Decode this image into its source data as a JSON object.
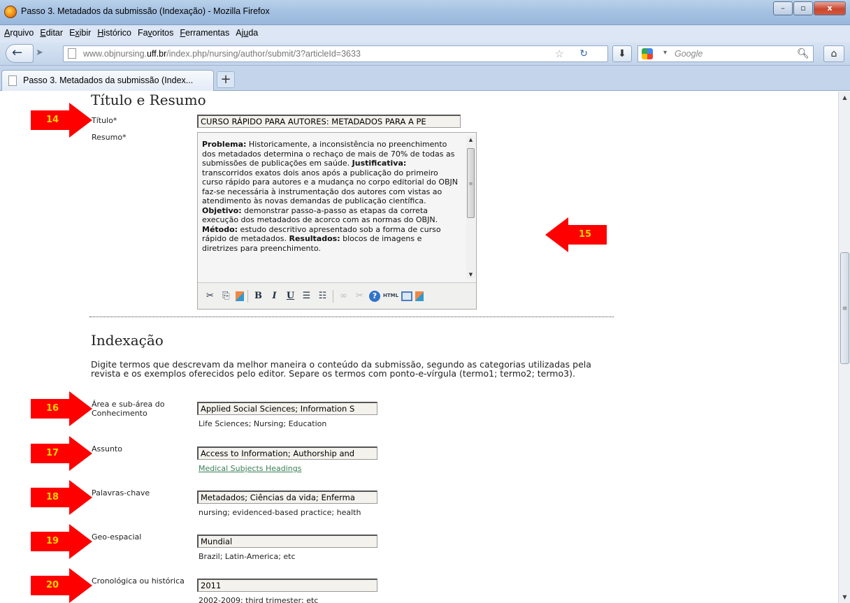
{
  "window": {
    "title": "Passo 3. Metadados da submissão (Indexação) - Mozilla Firefox",
    "minimize": "–",
    "maximize": "▫",
    "close": "x"
  },
  "menu": [
    "Arquivo",
    "Editar",
    "Exibir",
    "Histórico",
    "Favoritos",
    "Ferramentas",
    "Ajuda"
  ],
  "menu_underline": [
    "A",
    "E",
    "x",
    "H",
    "v",
    "F",
    "u"
  ],
  "nav": {
    "url_prefix": "www.objnursing.",
    "url_domain": "uff.br",
    "url_suffix": "/index.php/nursing/author/submit/3?articleId=3633",
    "search_placeholder": "Google"
  },
  "tab": {
    "label": "Passo 3. Metadados da submissão (Index...",
    "new_tab": "+"
  },
  "title_section": {
    "heading": "Título e Resumo",
    "title_label": "Título*",
    "title_value": "CURSO RÁPIDO PARA AUTORES: METADADOS PARA A PE",
    "abstract_label": "Resumo*",
    "abstract_segments": [
      {
        "bold": true,
        "text": "Problema:"
      },
      {
        "bold": false,
        "text": " Historicamente, a inconsistência no preenchimento dos metadados determina o rechaço de mais de 70% de todas as submissões de publicações em saúde. "
      },
      {
        "bold": true,
        "text": "Justificativa:"
      },
      {
        "bold": false,
        "text": " transcorridos exatos dois anos após a publicação do primeiro curso rápido para autores e a mudança no corpo editorial do OBJN faz-se necessária à instrumentação dos autores com vistas ao atendimento às novas demandas de publicação científica. "
      },
      {
        "bold": true,
        "text": "Objetivo:"
      },
      {
        "bold": false,
        "text": " demonstrar passo-a-passo as etapas da correta execução dos metadados de acorco com as normas do OBJN. "
      },
      {
        "bold": true,
        "text": "Método:"
      },
      {
        "bold": false,
        "text": " estudo descritivo apresentado sob a forma de curso rápido de metadados. "
      },
      {
        "bold": true,
        "text": "Resultados:"
      },
      {
        "bold": false,
        "text": " blocos de imagens e diretrizes para preenchimento."
      }
    ],
    "toolbar": {
      "cut": "✂",
      "copy": "⎘",
      "paste": "📋",
      "bold": "B",
      "italic": "I",
      "underline": "U",
      "bullet_list": "☰",
      "numbered_list": "☷",
      "link": "∞",
      "unlink": "✂",
      "help": "?",
      "html": "HTML"
    }
  },
  "indexing": {
    "heading": "Indexação",
    "instructions": "Digite termos que descrevam da melhor maneira o conteúdo da submissão, segundo as categorias utilizadas pela revista e os exemplos oferecidos pelo editor. Separe os termos com ponto-e-vírgula (termo1; termo2; termo3).",
    "fields": [
      {
        "label": "Área e sub-área do Conhecimento",
        "value": "Applied Social Sciences; Information S",
        "hint": "Life Sciences; Nursing; Education",
        "hint_is_link": false
      },
      {
        "label": "Assunto",
        "value": "Access to Information; Authorship and",
        "hint": "Medical Subjects Headings",
        "hint_is_link": true
      },
      {
        "label": "Palavras-chave",
        "value": "Metadados; Ciências da vida; Enferma",
        "hint": "nursing; evidenced-based practice; health",
        "hint_is_link": false
      },
      {
        "label": "Geo-espacial",
        "value": "Mundial",
        "hint": "Brazil; Latin-America; etc",
        "hint_is_link": false
      },
      {
        "label": "Cronológica ou histórica",
        "value": "2011",
        "hint": "2002-2009; third trimester; etc",
        "hint_is_link": false
      }
    ]
  },
  "markers": [
    "14",
    "15",
    "16",
    "17",
    "18",
    "19",
    "20"
  ],
  "colors": {
    "marker": "#ff0000",
    "marker_text": "#ffd400",
    "link": "#3b7f57"
  }
}
